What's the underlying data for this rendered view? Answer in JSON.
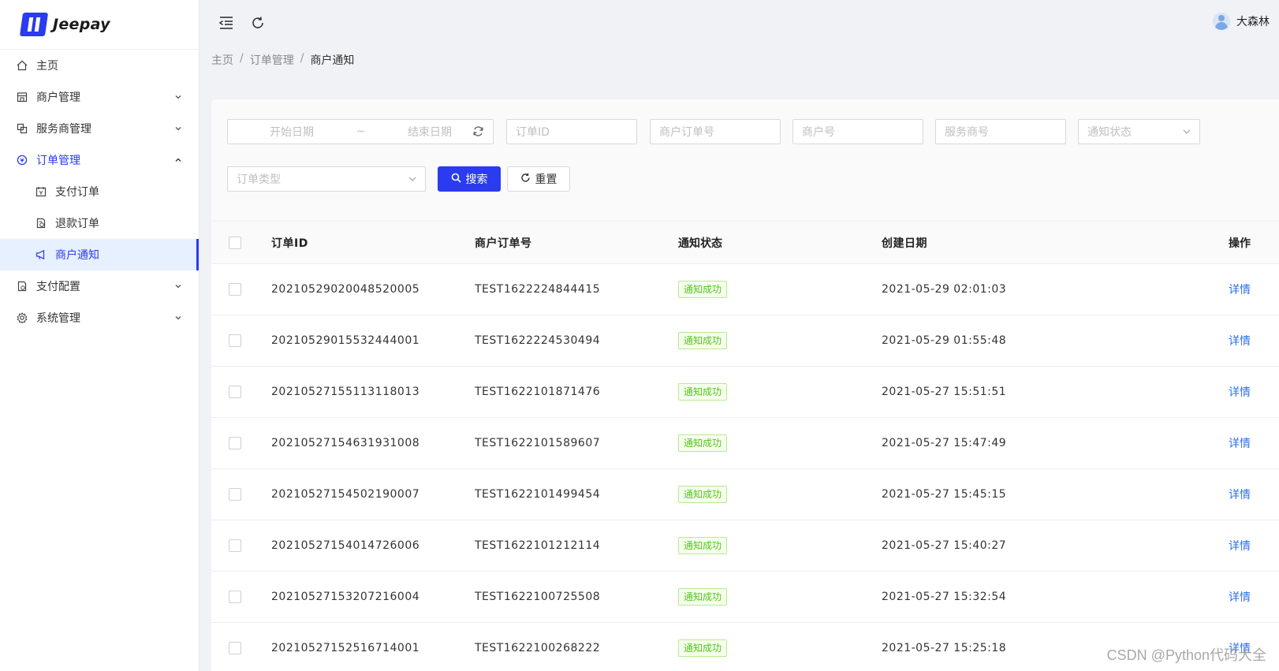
{
  "app": {
    "name": "Jeepay"
  },
  "sidebar": {
    "items": [
      {
        "label": "主页",
        "icon": "home-icon"
      },
      {
        "label": "商户管理",
        "icon": "shop-icon"
      },
      {
        "label": "服务商管理",
        "icon": "partner-icon"
      },
      {
        "label": "订单管理",
        "icon": "order-icon",
        "expanded": true
      },
      {
        "label": "支付订单",
        "icon": "calendar-icon"
      },
      {
        "label": "退款订单",
        "icon": "refund-icon"
      },
      {
        "label": "商户通知",
        "icon": "notification-icon",
        "selected": true
      },
      {
        "label": "支付配置",
        "icon": "config-icon"
      },
      {
        "label": "系统管理",
        "icon": "gear-icon"
      }
    ]
  },
  "header": {
    "user_name": "大森林"
  },
  "breadcrumb": [
    "主页",
    "订单管理",
    "商户通知"
  ],
  "filters": {
    "start_date_placeholder": "开始日期",
    "range_sep": "~",
    "end_date_placeholder": "结束日期",
    "order_id_placeholder": "订单ID",
    "mch_order_no_placeholder": "商户订单号",
    "mch_no_placeholder": "商户号",
    "isv_no_placeholder": "服务商号",
    "notify_state_placeholder": "通知状态",
    "order_type_placeholder": "订单类型",
    "search_label": "搜索",
    "reset_label": "重置"
  },
  "table": {
    "columns": [
      "订单ID",
      "商户订单号",
      "通知状态",
      "创建日期",
      "操作"
    ],
    "rows": [
      {
        "order_id": "20210529020048520005",
        "mch_order_no": "TEST1622224844415",
        "status": "通知成功",
        "created": "2021-05-29 02:01:03",
        "action": "详情"
      },
      {
        "order_id": "20210529015532444001",
        "mch_order_no": "TEST1622224530494",
        "status": "通知成功",
        "created": "2021-05-29 01:55:48",
        "action": "详情"
      },
      {
        "order_id": "20210527155113118013",
        "mch_order_no": "TEST1622101871476",
        "status": "通知成功",
        "created": "2021-05-27 15:51:51",
        "action": "详情"
      },
      {
        "order_id": "20210527154631931008",
        "mch_order_no": "TEST1622101589607",
        "status": "通知成功",
        "created": "2021-05-27 15:47:49",
        "action": "详情"
      },
      {
        "order_id": "20210527154502190007",
        "mch_order_no": "TEST1622101499454",
        "status": "通知成功",
        "created": "2021-05-27 15:45:15",
        "action": "详情"
      },
      {
        "order_id": "20210527154014726006",
        "mch_order_no": "TEST1622101212114",
        "status": "通知成功",
        "created": "2021-05-27 15:40:27",
        "action": "详情"
      },
      {
        "order_id": "20210527153207216004",
        "mch_order_no": "TEST1622100725508",
        "status": "通知成功",
        "created": "2021-05-27 15:32:54",
        "action": "详情"
      },
      {
        "order_id": "20210527152516714001",
        "mch_order_no": "TEST1622100268222",
        "status": "通知成功",
        "created": "2021-05-27 15:25:18",
        "action": "详情"
      }
    ]
  },
  "watermark": "CSDN @Python代码大全",
  "colors": {
    "primary": "#2a3bf0",
    "success": "#52c41a",
    "link": "#2a6ff0"
  }
}
